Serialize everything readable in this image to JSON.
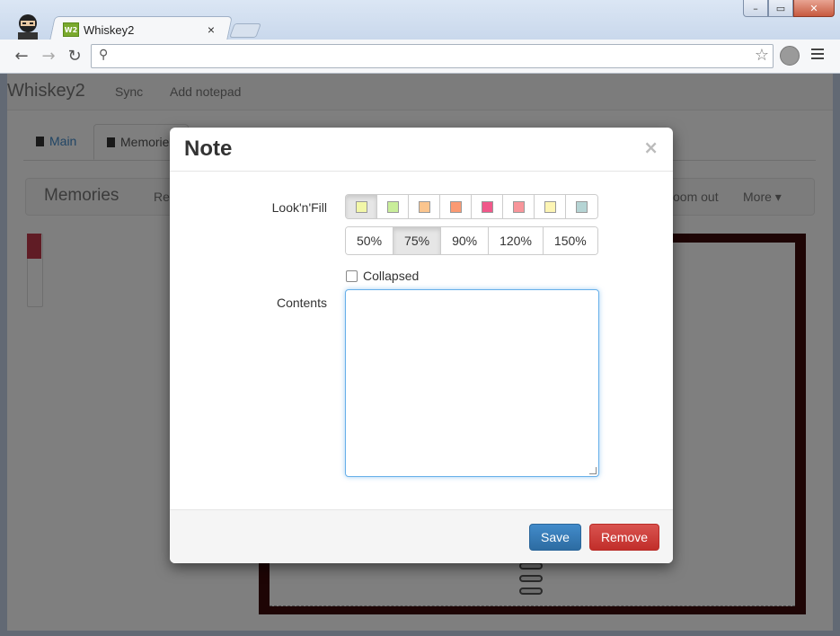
{
  "browser": {
    "tab_title": "Whiskey2",
    "favicon_text": "W2",
    "tab_close": "×",
    "window_buttons": [
      "–",
      "▭",
      "✕"
    ],
    "address": ""
  },
  "page": {
    "brand": "Whiskey2",
    "nav": [
      "Sync",
      "Add notepad"
    ],
    "tabs": [
      "Main",
      "Memories"
    ],
    "subbar_title": "Memories",
    "subbar_left_link": "Re",
    "subbar_zoom_out": "oom out",
    "subbar_more": "More ▾"
  },
  "modal": {
    "title": "Note",
    "close": "×",
    "look_label": "Look'n'Fill",
    "colors": [
      "#f2f7a8",
      "#c9ee9a",
      "#fbc58e",
      "#fb9a73",
      "#f0588a",
      "#f8959a",
      "#fdf5b4",
      "#b5d4d4"
    ],
    "selected_color_index": 0,
    "zoom_options": [
      "50%",
      "75%",
      "90%",
      "120%",
      "150%"
    ],
    "selected_zoom": "75%",
    "collapsed_label": "Collapsed",
    "collapsed_checked": false,
    "contents_label": "Contents",
    "contents_value": "",
    "save_label": "Save",
    "remove_label": "Remove"
  }
}
